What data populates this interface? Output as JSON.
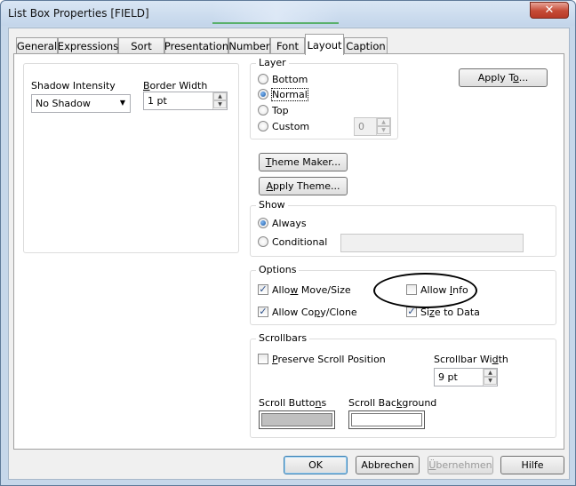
{
  "window": {
    "title": "List Box Properties [FIELD]",
    "close_glyph": "✕"
  },
  "tabs": [
    {
      "label": "General"
    },
    {
      "label": "Expressions"
    },
    {
      "label": "Sort"
    },
    {
      "label": "Presentation"
    },
    {
      "label": "Number"
    },
    {
      "label": "Font"
    },
    {
      "label": "Layout",
      "active": true
    },
    {
      "label": "Caption"
    }
  ],
  "shadow": {
    "label": "Shadow Intensity",
    "value": "No Shadow",
    "arrow": "▼"
  },
  "border": {
    "label": "Border Width",
    "value": "1 pt"
  },
  "layer": {
    "label": "Layer",
    "options": [
      "Bottom",
      "Normal",
      "Top",
      "Custom"
    ],
    "selected": "Normal",
    "custom_value": "0"
  },
  "buttons": {
    "apply_to": "Apply To...",
    "theme_maker": "Theme Maker...",
    "apply_theme": "Apply Theme...",
    "ok": "OK",
    "cancel": "Abbrechen",
    "apply": "Übernehmen",
    "help": "Hilfe"
  },
  "show": {
    "label": "Show",
    "always": "Always",
    "conditional": "Conditional",
    "selected": "Always"
  },
  "options": {
    "label": "Options",
    "allow_move_size": {
      "label": "Allow Move/Size",
      "checked": true
    },
    "allow_info": {
      "label": "Allow Info",
      "checked": false
    },
    "allow_copy_clone": {
      "label": "Allow Copy/Clone",
      "checked": true
    },
    "size_to_data": {
      "label": "Size to Data",
      "checked": true
    }
  },
  "scrollbars": {
    "label": "Scrollbars",
    "preserve_scroll": {
      "label": "Preserve Scroll Position",
      "checked": false
    },
    "width_label": "Scrollbar Width",
    "width_value": "9 pt",
    "buttons_label": "Scroll Buttons",
    "background_label": "Scroll Background",
    "buttons_color": "#c0c0c0",
    "background_color": "#ffffff"
  },
  "colors": {
    "client_bg": "#f0f0f0",
    "close_btn": "#c54a35",
    "annotation": "#000000"
  }
}
